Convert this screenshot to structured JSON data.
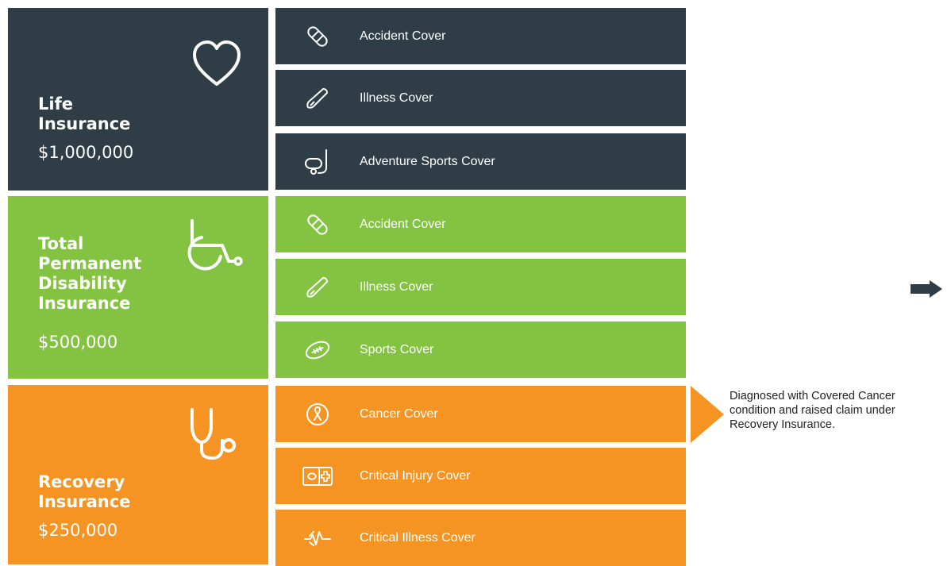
{
  "groups": [
    {
      "title": "Life\nInsurance",
      "amount": "$1,000,000",
      "icon": "heart-icon",
      "color": "#2f3e46",
      "covers": [
        {
          "label": "Accident Cover",
          "icon": "bandage-icon"
        },
        {
          "label": "Illness Cover",
          "icon": "thermometer-icon"
        },
        {
          "label": "Adventure Sports Cover",
          "icon": "snorkel-mask-icon"
        }
      ]
    },
    {
      "title": "Total\nPermanent\nDisability\nInsurance",
      "amount": "$500,000",
      "icon": "wheelchair-icon",
      "color": "#83c341",
      "covers": [
        {
          "label": "Accident Cover",
          "icon": "bandage-icon"
        },
        {
          "label": "Illness Cover",
          "icon": "thermometer-icon"
        },
        {
          "label": "Sports Cover",
          "icon": "rugby-ball-icon"
        }
      ]
    },
    {
      "title": "Recovery\nInsurance",
      "amount": "$250,000",
      "icon": "stethoscope-icon",
      "color": "#f59422",
      "covers": [
        {
          "label": "Cancer Cover",
          "icon": "cancer-ribbon-icon"
        },
        {
          "label": "Critical Injury Cover",
          "icon": "bone-medical-icon"
        },
        {
          "label": "Critical Illness Cover",
          "icon": "heartbeat-icon"
        }
      ]
    }
  ],
  "note": "Diagnosed with Covered Cancer condition and raised claim under Recovery Insurance."
}
